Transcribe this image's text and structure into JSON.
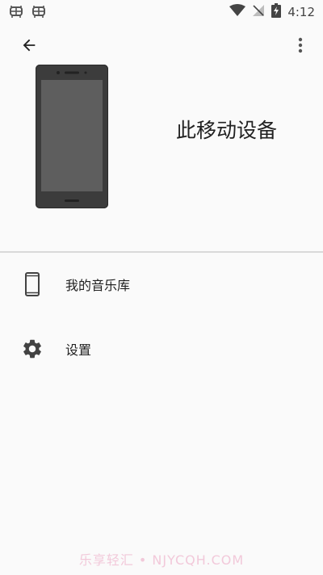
{
  "status_bar": {
    "left_icons": [
      "android-debug-icon",
      "android-debug-icon"
    ],
    "right_icons": [
      "wifi-icon",
      "signal-off-icon",
      "battery-charging-icon"
    ],
    "time": "4:12"
  },
  "toolbar": {
    "back_icon": "arrow-back-icon",
    "more_icon": "more-vert-icon"
  },
  "header": {
    "device_title": "此移动设备"
  },
  "list": {
    "items": [
      {
        "label": "我的音乐库",
        "icon": "phone-icon"
      },
      {
        "label": "设置",
        "icon": "gear-icon"
      }
    ]
  },
  "watermark": {
    "text": "乐享轻汇 • NJYCQH.COM"
  },
  "colors": {
    "background": "#fafafa",
    "text_primary": "#212121",
    "divider": "#d9d9d9",
    "icon": "#424242",
    "device_body": "#3c3c3c",
    "device_screen": "#5e5e5e",
    "watermark": "#f2c9da"
  }
}
